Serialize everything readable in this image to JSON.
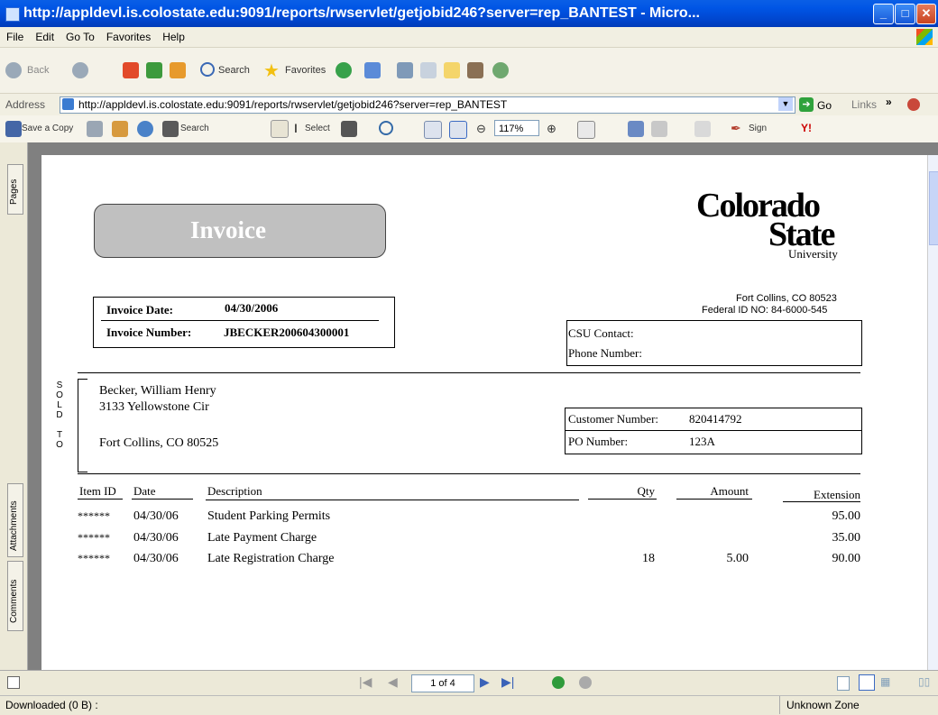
{
  "window": {
    "title": "http://appldevl.is.colostate.edu:9091/reports/rwservlet/getjobid246?server=rep_BANTEST - Micro..."
  },
  "menu": [
    "File",
    "Edit",
    "Go To",
    "Favorites",
    "Help"
  ],
  "toolbar": {
    "back": "Back",
    "search": "Search",
    "favorites": "Favorites"
  },
  "address": {
    "label": "Address",
    "url": "http://appldevl.is.colostate.edu:9091/reports/rwservlet/getjobid246?server=rep_BANTEST",
    "go": "Go",
    "links": "Links"
  },
  "acrobat": {
    "save_copy": "Save a Copy",
    "search": "Search",
    "select": "Select",
    "zoom": "117%",
    "sign": "Sign"
  },
  "sidetabs": [
    "Pages",
    "Attachments",
    "Comments"
  ],
  "invoice": {
    "header": "Invoice",
    "logo_line1": "Colorado",
    "logo_line2": "State",
    "logo_line3": "University",
    "date_label": "Invoice Date:",
    "date_value": "04/30/2006",
    "number_label": "Invoice Number:",
    "number_value": "JBECKER200604300001",
    "city": "Fort Collins, CO 80523",
    "federal_id": "Federal ID NO:  84-6000-545",
    "contact_label": "CSU Contact:",
    "phone_label": "Phone Number:",
    "sold_to_letters": [
      "S",
      "O",
      "L",
      "D",
      "",
      "T",
      "O"
    ],
    "customer_name": "Becker, William Henry",
    "address1": "3133 Yellowstone Cir",
    "address2": "Fort Collins, CO 80525",
    "customer_number_label": "Customer Number:",
    "customer_number_value": "820414792",
    "po_label": "PO Number:",
    "po_value": "123A",
    "columns": {
      "item_id": "Item ID",
      "date": "Date",
      "description": "Description",
      "qty": "Qty",
      "amount": "Amount",
      "extension": "Extension"
    },
    "rows": [
      {
        "item_id": "******",
        "date": "04/30/06",
        "description": "Student Parking Permits",
        "qty": "",
        "amount": "",
        "extension": "95.00"
      },
      {
        "item_id": "******",
        "date": "04/30/06",
        "description": "Late Payment Charge",
        "qty": "",
        "amount": "",
        "extension": "35.00"
      },
      {
        "item_id": "******",
        "date": "04/30/06",
        "description": "Late Registration Charge",
        "qty": "18",
        "amount": "5.00",
        "extension": "90.00"
      }
    ]
  },
  "nav": {
    "page_indicator": "1 of 4"
  },
  "status": {
    "left": "Downloaded  (0 B) :",
    "zone": "Unknown Zone"
  }
}
